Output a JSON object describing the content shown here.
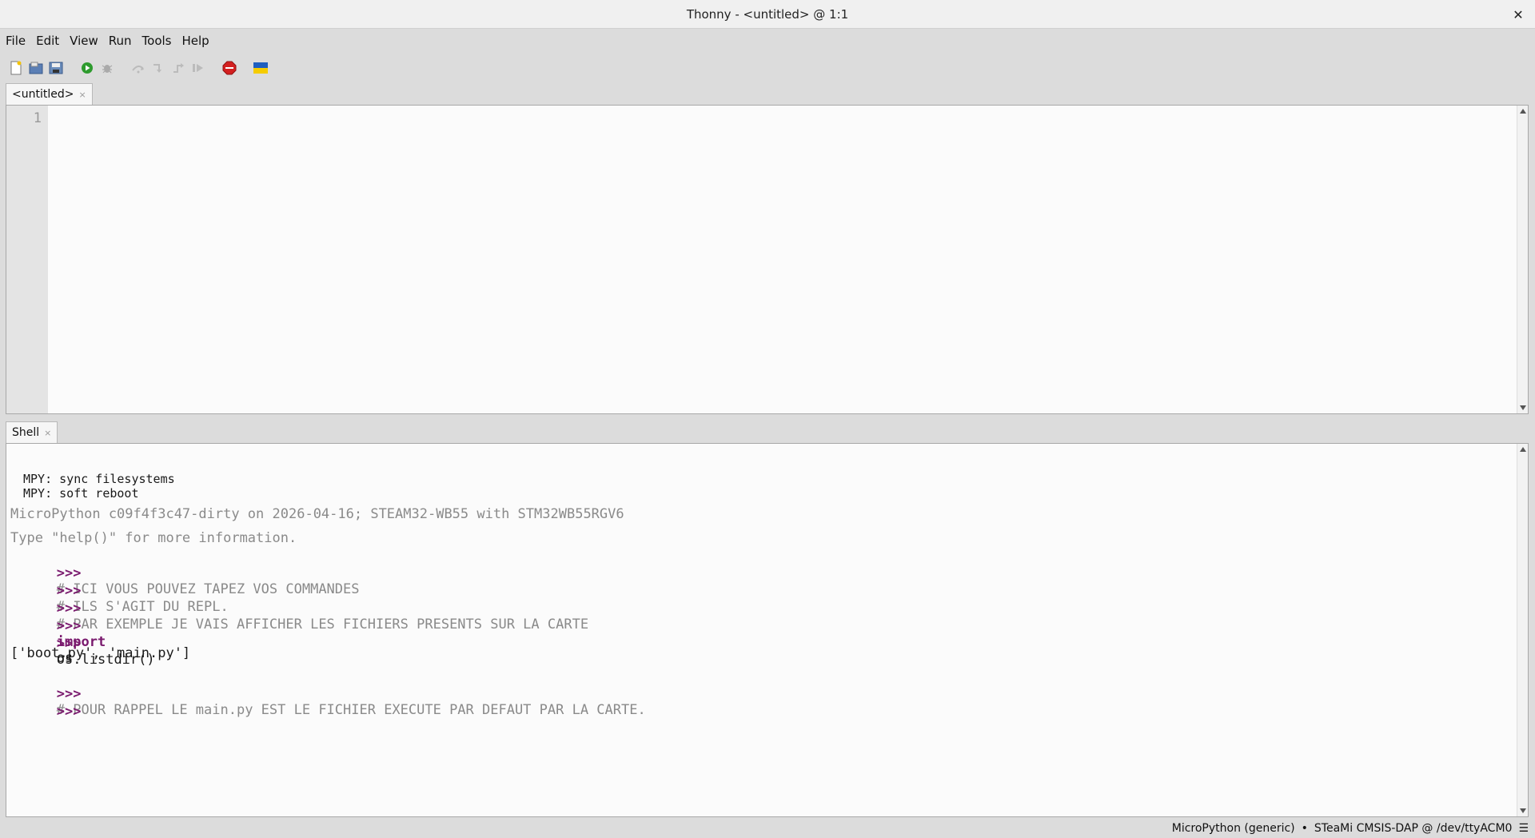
{
  "window": {
    "title": "Thonny - <untitled> @ 1:1",
    "close_glyph": "✕"
  },
  "menu": {
    "items": [
      "File",
      "Edit",
      "View",
      "Run",
      "Tools",
      "Help"
    ]
  },
  "toolbar": {
    "buttons": [
      "new-file",
      "open-file",
      "save-file",
      "run",
      "debug",
      "step-over",
      "step-into",
      "step-out",
      "resume",
      "stop",
      "ukraine-flag"
    ]
  },
  "editor": {
    "tab_label": "<untitled>",
    "tab_close": "×",
    "line_numbers": [
      "1"
    ]
  },
  "shell": {
    "tab_label": "Shell",
    "tab_close": "×",
    "sys_lines": [
      "MPY: sync filesystems",
      "MPY: soft reboot"
    ],
    "banner_1": "MicroPython c09f4f3c47-dirty on 2026-04-16; STEAM32-WB55 with STM32WB55RGV6",
    "banner_2": "Type \"help()\" for more information.",
    "prompt": ">>>",
    "comment_1": "# ICI VOUS POUVEZ TAPEZ VOS COMMANDES",
    "comment_2": "# ILS S'AGIT DU REPL.",
    "comment_3": "# PAR EXEMPLE JE VAIS AFFICHER LES FICHIERS PRESENTS SUR LA CARTE",
    "import_kw": "import",
    "import_mod": "os",
    "call": "os.listdir()",
    "output": "['boot.py', 'main.py']",
    "comment_4": "# POUR RAPPEL LE main.py EST LE FICHIER EXECUTE PAR DEFAUT PAR LA CARTE."
  },
  "status": {
    "interpreter": "MicroPython (generic)",
    "separator": "•",
    "port": "STeaMi CMSIS-DAP @ /dev/ttyACM0",
    "menu_glyph": "☰"
  },
  "colors": {
    "prompt": "#7a1a6e",
    "comment": "#8a8a8a",
    "run_green": "#2e9b2e",
    "stop_red": "#d32020"
  }
}
